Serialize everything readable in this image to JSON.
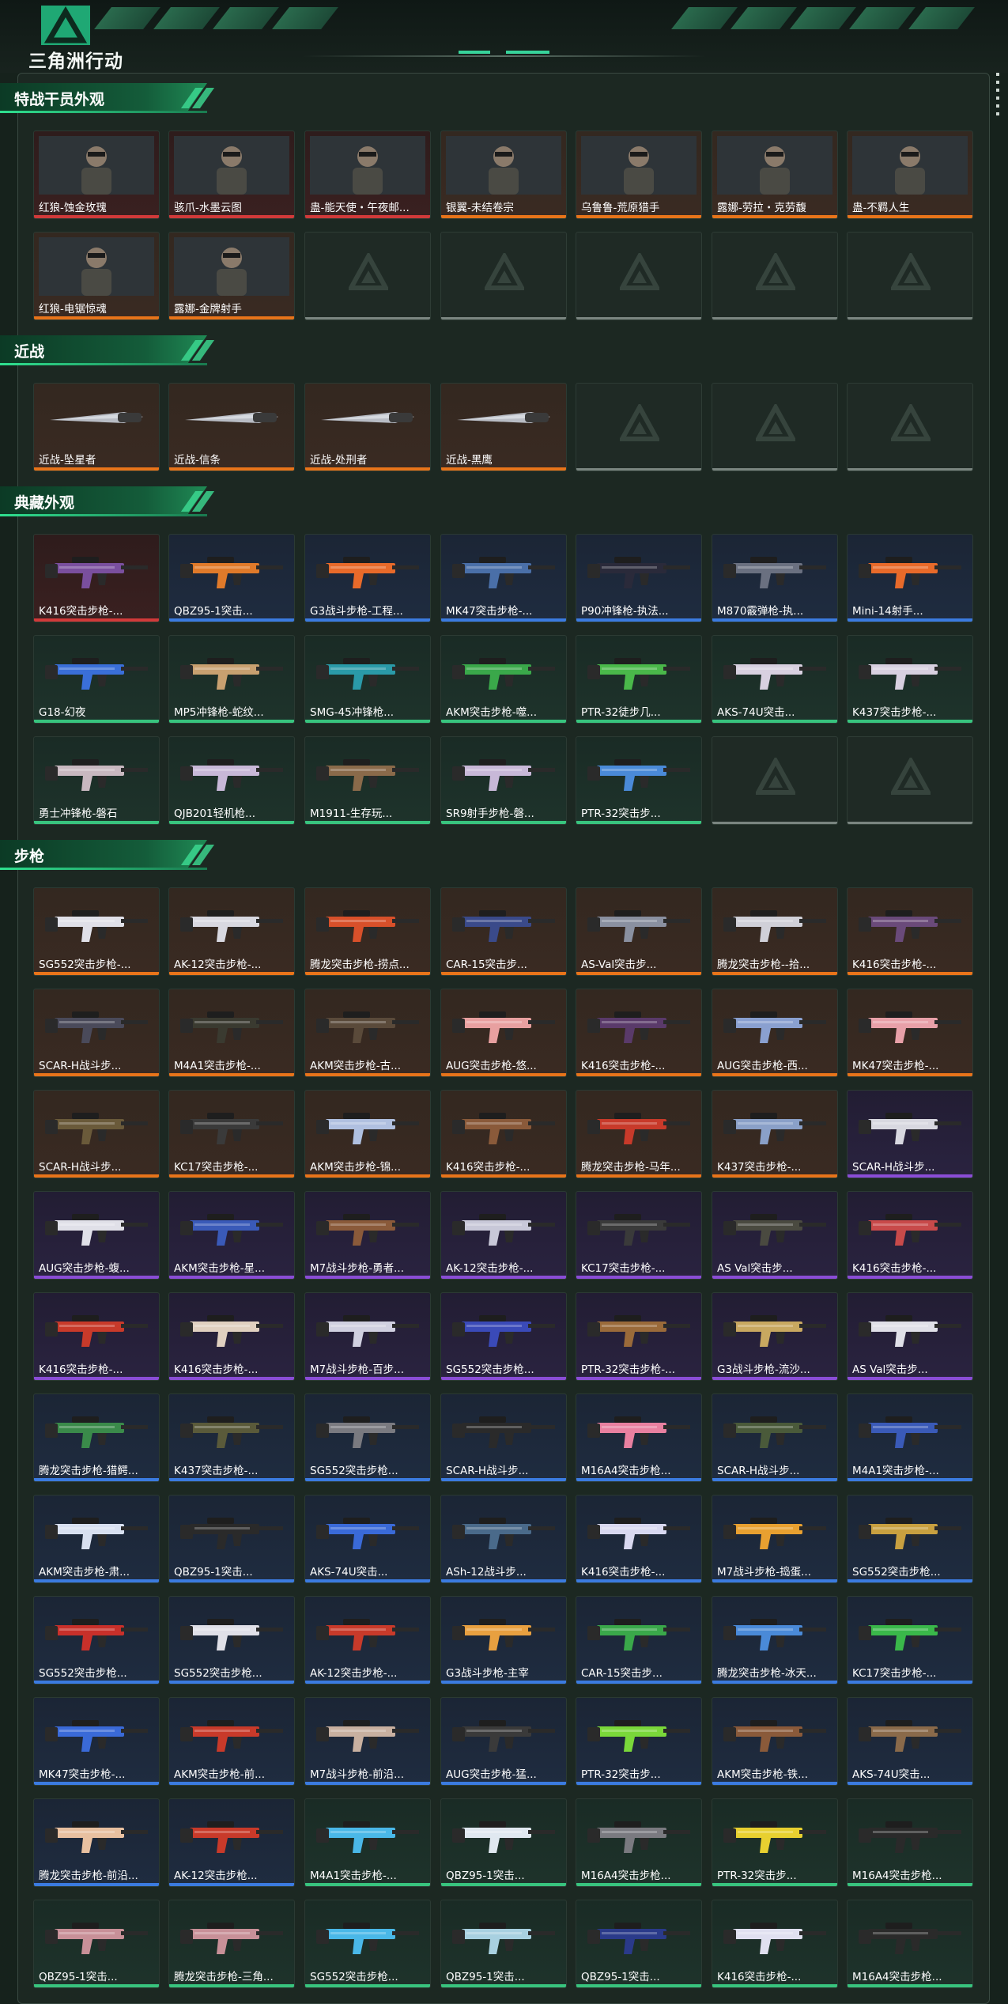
{
  "header": {
    "brand": "三角洲行动"
  },
  "accent": "#2fe08f",
  "sections": [
    {
      "title": "特战干员外观",
      "items": [
        {
          "label": "红狼-蚀金玫瑰",
          "rarity": "red",
          "kind": "operator"
        },
        {
          "label": "骇爪-水墨云图",
          "rarity": "red",
          "kind": "operator"
        },
        {
          "label": "蛊-能天使・午夜邮...",
          "rarity": "red",
          "kind": "operator"
        },
        {
          "label": "银翼-未结卷宗",
          "rarity": "orange",
          "kind": "operator"
        },
        {
          "label": "乌鲁鲁-荒原猎手",
          "rarity": "orange",
          "kind": "operator"
        },
        {
          "label": "露娜-劳拉・克劳馥",
          "rarity": "orange",
          "kind": "operator"
        },
        {
          "label": "蛊-不羁人生",
          "rarity": "orange",
          "kind": "operator"
        },
        {
          "label": "红狼-电锯惊魂",
          "rarity": "orange",
          "kind": "operator"
        },
        {
          "label": "露娜-金牌射手",
          "rarity": "orange",
          "kind": "operator"
        },
        {
          "label": "",
          "rarity": "empty"
        },
        {
          "label": "",
          "rarity": "empty"
        },
        {
          "label": "",
          "rarity": "empty"
        },
        {
          "label": "",
          "rarity": "empty"
        },
        {
          "label": "",
          "rarity": "empty"
        }
      ]
    },
    {
      "title": "近战",
      "items": [
        {
          "label": "近战-坠星者",
          "rarity": "orange",
          "kind": "melee"
        },
        {
          "label": "近战-信条",
          "rarity": "orange",
          "kind": "melee"
        },
        {
          "label": "近战-处刑者",
          "rarity": "orange",
          "kind": "melee"
        },
        {
          "label": "近战-黑鹰",
          "rarity": "orange",
          "kind": "melee"
        },
        {
          "label": "",
          "rarity": "empty"
        },
        {
          "label": "",
          "rarity": "empty"
        },
        {
          "label": "",
          "rarity": "empty"
        }
      ]
    },
    {
      "title": "典藏外观",
      "items": [
        {
          "label": "K416突击步枪-...",
          "rarity": "red",
          "kind": "gun",
          "color": "#7a4f9e"
        },
        {
          "label": "QBZ95-1突击...",
          "rarity": "blue",
          "kind": "gun",
          "color": "#e07a2a"
        },
        {
          "label": "G3战斗步枪-工程...",
          "rarity": "blue",
          "kind": "gun",
          "color": "#e86a2a"
        },
        {
          "label": "MK47突击步枪-...",
          "rarity": "blue",
          "kind": "gun",
          "color": "#4a6fa8"
        },
        {
          "label": "P90冲锋枪-执法...",
          "rarity": "blue",
          "kind": "gun",
          "color": "#2a2a3a"
        },
        {
          "label": "M870霰弹枪-执...",
          "rarity": "blue",
          "kind": "gun",
          "color": "#6a7080"
        },
        {
          "label": "Mini-14射手...",
          "rarity": "blue",
          "kind": "gun",
          "color": "#e86a2a"
        },
        {
          "label": "G18-幻夜",
          "rarity": "green",
          "kind": "gun",
          "color": "#3a6fd8"
        },
        {
          "label": "MP5冲锋枪-蛇纹...",
          "rarity": "green",
          "kind": "gun",
          "color": "#c8a070"
        },
        {
          "label": "SMG-45冲锋枪...",
          "rarity": "green",
          "kind": "gun",
          "color": "#2a9aa8"
        },
        {
          "label": "AKM突击步枪-噬...",
          "rarity": "green",
          "kind": "gun",
          "color": "#3aa84a"
        },
        {
          "label": "PTR-32徒步几...",
          "rarity": "green",
          "kind": "gun",
          "color": "#4ab84a"
        },
        {
          "label": "AKS-74U突击...",
          "rarity": "green",
          "kind": "gun",
          "color": "#d8d0e0"
        },
        {
          "label": "K437突击步枪-...",
          "rarity": "green",
          "kind": "gun",
          "color": "#d8d0e0"
        },
        {
          "label": "勇士冲锋枪-磐石",
          "rarity": "green",
          "kind": "gun",
          "color": "#c8b8c0"
        },
        {
          "label": "QJB201轻机枪...",
          "rarity": "green",
          "kind": "gun",
          "color": "#c8b8d8"
        },
        {
          "label": "M1911-生存玩...",
          "rarity": "green",
          "kind": "gun",
          "color": "#8a6a4a"
        },
        {
          "label": "SR9射手步枪-磐...",
          "rarity": "green",
          "kind": "gun",
          "color": "#c8b8d8"
        },
        {
          "label": "PTR-32突击步...",
          "rarity": "green",
          "kind": "gun",
          "color": "#4a8ad8"
        },
        {
          "label": "",
          "rarity": "empty"
        },
        {
          "label": "",
          "rarity": "empty"
        }
      ]
    },
    {
      "title": "步枪",
      "items": [
        {
          "label": "SG552突击步枪-...",
          "rarity": "orange",
          "kind": "gun",
          "color": "#e0e0e8"
        },
        {
          "label": "AK-12突击步枪-...",
          "rarity": "orange",
          "kind": "gun",
          "color": "#d8d8e0"
        },
        {
          "label": "腾龙突击步枪-捞点...",
          "rarity": "orange",
          "kind": "gun",
          "color": "#d8502a"
        },
        {
          "label": "CAR-15突击步...",
          "rarity": "orange",
          "kind": "gun",
          "color": "#3a4a8a"
        },
        {
          "label": "AS-Val突击步...",
          "rarity": "orange",
          "kind": "gun",
          "color": "#8a90a0"
        },
        {
          "label": "腾龙突击步枪--拾...",
          "rarity": "orange",
          "kind": "gun",
          "color": "#d0d0d8"
        },
        {
          "label": "K416突击步枪-...",
          "rarity": "orange",
          "kind": "gun",
          "color": "#6a4a7a"
        },
        {
          "label": "SCAR-H战斗步...",
          "rarity": "orange",
          "kind": "gun",
          "color": "#4a4a5a"
        },
        {
          "label": "M4A1突击步枪-...",
          "rarity": "orange",
          "kind": "gun",
          "color": "#3a3a30"
        },
        {
          "label": "AKM突击步枪-古...",
          "rarity": "orange",
          "kind": "gun",
          "color": "#5a4a3a"
        },
        {
          "label": "AUG突击步枪-悠...",
          "rarity": "orange",
          "kind": "gun",
          "color": "#e8a0a0"
        },
        {
          "label": "K416突击步枪-...",
          "rarity": "orange",
          "kind": "gun",
          "color": "#5a3a6a"
        },
        {
          "label": "AUG突击步枪-西...",
          "rarity": "orange",
          "kind": "gun",
          "color": "#8aa0d0"
        },
        {
          "label": "MK47突击步枪-...",
          "rarity": "orange",
          "kind": "gun",
          "color": "#e8a0a8"
        },
        {
          "label": "SCAR-H战斗步...",
          "rarity": "orange",
          "kind": "gun",
          "color": "#6a5a3a"
        },
        {
          "label": "KC17突击步枪-...",
          "rarity": "orange",
          "kind": "gun",
          "color": "#3a3a3a"
        },
        {
          "label": "AKM突击步枪-锦...",
          "rarity": "orange",
          "kind": "gun",
          "color": "#b0c0e0"
        },
        {
          "label": "K416突击步枪-...",
          "rarity": "orange",
          "kind": "gun",
          "color": "#8a5a3a"
        },
        {
          "label": "腾龙突击步枪-马年...",
          "rarity": "orange",
          "kind": "gun",
          "color": "#c83a2a"
        },
        {
          "label": "K437突击步枪-...",
          "rarity": "orange",
          "kind": "gun",
          "color": "#8aa0c8"
        },
        {
          "label": "SCAR-H战斗步...",
          "rarity": "purple",
          "kind": "gun",
          "color": "#d8d8e0"
        },
        {
          "label": "AUG突击步枪-蝮...",
          "rarity": "purple",
          "kind": "gun",
          "color": "#e0e0e8"
        },
        {
          "label": "AKM突击步枪-星...",
          "rarity": "purple",
          "kind": "gun",
          "color": "#3a5ab8"
        },
        {
          "label": "M7战斗步枪-勇者...",
          "rarity": "purple",
          "kind": "gun",
          "color": "#8a5a3a"
        },
        {
          "label": "AK-12突击步枪-...",
          "rarity": "purple",
          "kind": "gun",
          "color": "#c8c8d8"
        },
        {
          "label": "KC17突击步枪-...",
          "rarity": "purple",
          "kind": "gun",
          "color": "#3a3a3a"
        },
        {
          "label": "AS Val突击步...",
          "rarity": "purple",
          "kind": "gun",
          "color": "#4a4a40"
        },
        {
          "label": "K416突击步枪-...",
          "rarity": "purple",
          "kind": "gun",
          "color": "#c84a4a"
        },
        {
          "label": "K416突击步枪-...",
          "rarity": "purple",
          "kind": "gun",
          "color": "#c83a2a"
        },
        {
          "label": "K416突击步枪-...",
          "rarity": "purple",
          "kind": "gun",
          "color": "#e0d0c0"
        },
        {
          "label": "M7战斗步枪-百步...",
          "rarity": "purple",
          "kind": "gun",
          "color": "#d0d0e0"
        },
        {
          "label": "SG552突击步枪...",
          "rarity": "purple",
          "kind": "gun",
          "color": "#3a4ab8"
        },
        {
          "label": "PTR-32突击步枪-...",
          "rarity": "purple",
          "kind": "gun",
          "color": "#9a6a3a"
        },
        {
          "label": "G3战斗步枪-流沙...",
          "rarity": "purple",
          "kind": "gun",
          "color": "#c8a860"
        },
        {
          "label": "AS Val突击步...",
          "rarity": "purple",
          "kind": "gun",
          "color": "#e0e0e8"
        },
        {
          "label": "腾龙突击步枪-猎鳄...",
          "rarity": "blue",
          "kind": "gun",
          "color": "#3a8a4a"
        },
        {
          "label": "K437突击步枪-...",
          "rarity": "blue",
          "kind": "gun",
          "color": "#5a5a3a"
        },
        {
          "label": "SG552突击步枪...",
          "rarity": "blue",
          "kind": "gun",
          "color": "#7a7a80"
        },
        {
          "label": "SCAR-H战斗步...",
          "rarity": "blue",
          "kind": "gun",
          "color": "#2a2a2a"
        },
        {
          "label": "M16A4突击步枪...",
          "rarity": "blue",
          "kind": "gun",
          "color": "#e880a0"
        },
        {
          "label": "SCAR-H战斗步...",
          "rarity": "blue",
          "kind": "gun",
          "color": "#4a5a3a"
        },
        {
          "label": "M4A1突击步枪-...",
          "rarity": "blue",
          "kind": "gun",
          "color": "#3a5ab8"
        },
        {
          "label": "AKM突击步枪-肃...",
          "rarity": "blue",
          "kind": "gun",
          "color": "#d8e0f0"
        },
        {
          "label": "QBZ95-1突击...",
          "rarity": "blue",
          "kind": "gun",
          "color": "#2a2a2a"
        },
        {
          "label": "AKS-74U突击...",
          "rarity": "blue",
          "kind": "gun",
          "color": "#3a6ad8"
        },
        {
          "label": "ASh-12战斗步...",
          "rarity": "blue",
          "kind": "gun",
          "color": "#4a6a8a"
        },
        {
          "label": "K416突击步枪-...",
          "rarity": "blue",
          "kind": "gun",
          "color": "#d8d8f0"
        },
        {
          "label": "M7战斗步枪-捣蛋...",
          "rarity": "blue",
          "kind": "gun",
          "color": "#e8a030"
        },
        {
          "label": "SG552突击步枪...",
          "rarity": "blue",
          "kind": "gun",
          "color": "#c8a040"
        },
        {
          "label": "SG552突击步枪...",
          "rarity": "blue",
          "kind": "gun",
          "color": "#c8302a"
        },
        {
          "label": "SG552突击步枪...",
          "rarity": "blue",
          "kind": "gun",
          "color": "#e0e0e8"
        },
        {
          "label": "AK-12突击步枪-...",
          "rarity": "blue",
          "kind": "gun",
          "color": "#c83a2a"
        },
        {
          "label": "G3战斗步枪-主宰",
          "rarity": "blue",
          "kind": "gun",
          "color": "#e8a040"
        },
        {
          "label": "CAR-15突击步...",
          "rarity": "blue",
          "kind": "gun",
          "color": "#3aa84a"
        },
        {
          "label": "腾龙突击步枪-冰天...",
          "rarity": "blue",
          "kind": "gun",
          "color": "#4a8ad8"
        },
        {
          "label": "KC17突击步枪-...",
          "rarity": "blue",
          "kind": "gun",
          "color": "#3ab84a"
        },
        {
          "label": "MK47突击步枪-...",
          "rarity": "blue",
          "kind": "gun",
          "color": "#3a6ad8"
        },
        {
          "label": "AKM突击步枪-前...",
          "rarity": "blue",
          "kind": "gun",
          "color": "#c83a2a"
        },
        {
          "label": "M7战斗步枪-前沿...",
          "rarity": "blue",
          "kind": "gun",
          "color": "#c8b0a0"
        },
        {
          "label": "AUG突击步枪-猛...",
          "rarity": "blue",
          "kind": "gun",
          "color": "#3a3a3a"
        },
        {
          "label": "PTR-32突击步...",
          "rarity": "blue",
          "kind": "gun",
          "color": "#7ad83a"
        },
        {
          "label": "AKM突击步枪-铁...",
          "rarity": "blue",
          "kind": "gun",
          "color": "#8a5a3a"
        },
        {
          "label": "AKS-74U突击...",
          "rarity": "blue",
          "kind": "gun",
          "color": "#8a6a4a"
        },
        {
          "label": "腾龙突击步枪-前沿...",
          "rarity": "blue",
          "kind": "gun",
          "color": "#e8c0a0"
        },
        {
          "label": "AK-12突击步枪...",
          "rarity": "blue",
          "kind": "gun",
          "color": "#c83a2a"
        },
        {
          "label": "M4A1突击步枪-...",
          "rarity": "green",
          "kind": "gun",
          "color": "#4ab8e8"
        },
        {
          "label": "QBZ95-1突击...",
          "rarity": "green",
          "kind": "gun",
          "color": "#e0e8f0"
        },
        {
          "label": "M16A4突击步枪...",
          "rarity": "green",
          "kind": "gun",
          "color": "#7a7a80"
        },
        {
          "label": "PTR-32突击步...",
          "rarity": "green",
          "kind": "gun",
          "color": "#e8d030"
        },
        {
          "label": "M16A4突击步枪...",
          "rarity": "green",
          "kind": "gun",
          "color": "#2a2a2a"
        },
        {
          "label": "QBZ95-1突击...",
          "rarity": "green",
          "kind": "gun",
          "color": "#c89098"
        },
        {
          "label": "腾龙突击步枪-三角...",
          "rarity": "green",
          "kind": "gun",
          "color": "#c89098"
        },
        {
          "label": "SG552突击步枪...",
          "rarity": "green",
          "kind": "gun",
          "color": "#4ab8e8"
        },
        {
          "label": "QBZ95-1突击...",
          "rarity": "green",
          "kind": "gun",
          "color": "#a8d0e0"
        },
        {
          "label": "QBZ95-1突击...",
          "rarity": "green",
          "kind": "gun",
          "color": "#2a3a8a"
        },
        {
          "label": "K416突击步枪-...",
          "rarity": "green",
          "kind": "gun",
          "color": "#e0e0f0"
        },
        {
          "label": "M16A4突击步枪...",
          "rarity": "green",
          "kind": "gun",
          "color": "#2a2a2a"
        }
      ]
    }
  ]
}
